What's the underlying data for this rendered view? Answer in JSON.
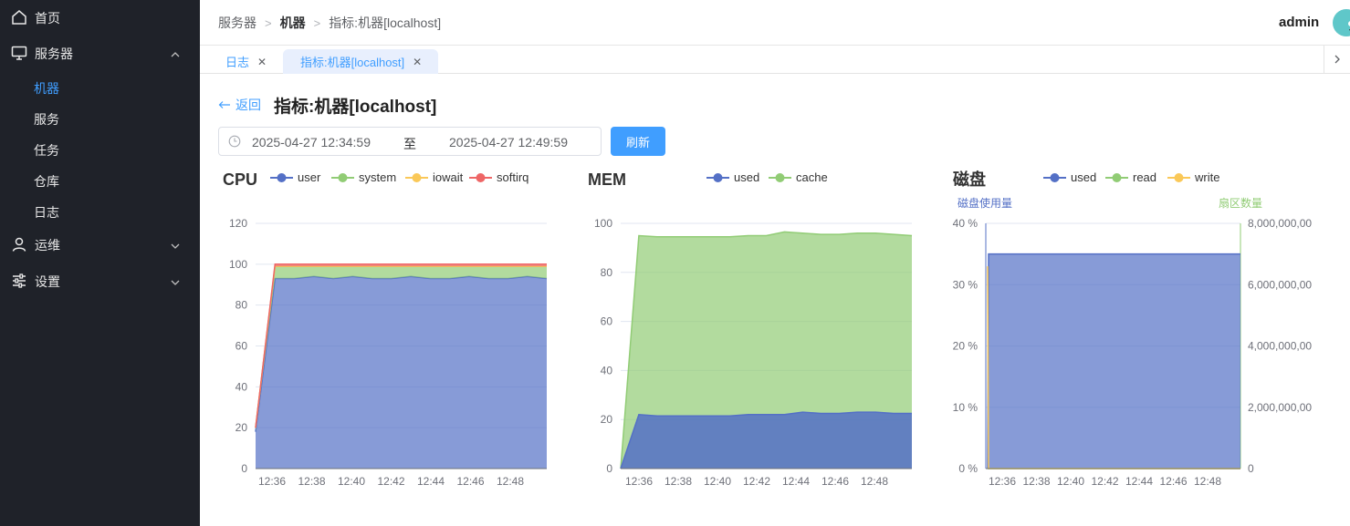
{
  "sidebar": {
    "items": [
      {
        "label": "首页",
        "icon": "home-icon"
      },
      {
        "label": "服务器",
        "icon": "monitor-icon",
        "expanded": true,
        "children": [
          {
            "label": "机器",
            "active": true
          },
          {
            "label": "服务"
          },
          {
            "label": "任务"
          },
          {
            "label": "仓库"
          },
          {
            "label": "日志"
          }
        ]
      },
      {
        "label": "运维",
        "icon": "user-icon",
        "expanded": false
      },
      {
        "label": "设置",
        "icon": "sliders-icon",
        "expanded": false
      }
    ]
  },
  "header": {
    "breadcrumb": [
      "服务器",
      "机器",
      "指标:机器[localhost]"
    ],
    "user": "admin"
  },
  "tabs": [
    {
      "label": "日志",
      "active": false
    },
    {
      "label": "指标:机器[localhost]",
      "active": true
    }
  ],
  "page": {
    "back_label": "返回",
    "title": "指标:机器[localhost]",
    "date_start": "2025-04-27 12:34:59",
    "date_sep": "至",
    "date_end": "2025-04-27 12:49:59",
    "refresh_label": "刷新"
  },
  "colors": {
    "accent": "#409eff",
    "sidebar_bg": "#1f2229",
    "blue": "#5470c6",
    "green": "#91cc75",
    "yellow": "#fac858",
    "red": "#ee6666"
  },
  "chart_data": [
    {
      "type": "area",
      "title": "CPU",
      "legend": [
        "user",
        "system",
        "iowait",
        "softirq"
      ],
      "x_ticks": [
        "12:36",
        "12:38",
        "12:40",
        "12:42",
        "12:44",
        "12:46",
        "12:48"
      ],
      "y_ticks": [
        "0",
        "20",
        "40",
        "60",
        "80",
        "100",
        "120"
      ],
      "ylim": [
        0,
        120
      ],
      "stacked": true,
      "series": [
        {
          "name": "user",
          "values": [
            18,
            93,
            93,
            94,
            93,
            94,
            93,
            93,
            94,
            93,
            93,
            94,
            93,
            93,
            94,
            93
          ]
        },
        {
          "name": "system",
          "values": [
            2,
            6,
            6,
            5,
            6,
            5,
            6,
            6,
            5,
            6,
            6,
            5,
            6,
            6,
            5,
            6
          ]
        },
        {
          "name": "iowait",
          "values": [
            0,
            0,
            0,
            0,
            0,
            0,
            0,
            0,
            0,
            0,
            0,
            0,
            0,
            0,
            0,
            0
          ]
        },
        {
          "name": "softirq",
          "values": [
            0,
            1,
            1,
            1,
            1,
            1,
            1,
            1,
            1,
            1,
            1,
            1,
            1,
            1,
            1,
            1
          ]
        }
      ]
    },
    {
      "type": "area",
      "title": "MEM",
      "legend": [
        "used",
        "cache"
      ],
      "x_ticks": [
        "12:36",
        "12:38",
        "12:40",
        "12:42",
        "12:44",
        "12:46",
        "12:48"
      ],
      "y_ticks": [
        "0",
        "20",
        "40",
        "60",
        "80",
        "100"
      ],
      "ylim": [
        0,
        100
      ],
      "series": [
        {
          "name": "used",
          "values": [
            0,
            22,
            21.5,
            21.5,
            21.5,
            21.5,
            21.5,
            22,
            22,
            22,
            23,
            22.5,
            22.5,
            23,
            23,
            22.5,
            22.5
          ]
        },
        {
          "name": "cache",
          "values": [
            0,
            95,
            94.5,
            94.5,
            94.5,
            94.5,
            94.5,
            95,
            95,
            96.5,
            96,
            95.5,
            95.5,
            96,
            96,
            95.5,
            95
          ]
        }
      ]
    },
    {
      "type": "area",
      "title": "磁盘",
      "legend": [
        "used",
        "read",
        "write"
      ],
      "left_axis_name": "磁盘使用量",
      "right_axis_name": "扇区数量",
      "x_ticks": [
        "12:36",
        "12:38",
        "12:40",
        "12:42",
        "12:44",
        "12:46",
        "12:48"
      ],
      "y_ticks_left": [
        "0 %",
        "10 %",
        "20 %",
        "30 %",
        "40 %"
      ],
      "y_ticks_right": [
        "0",
        "2,000,000,00",
        "4,000,000,00",
        "6,000,000,00",
        "8,000,000,00"
      ],
      "ylim_left": [
        0,
        40
      ],
      "ylim_right": [
        0,
        8000000000
      ],
      "series": [
        {
          "name": "used",
          "axis": "left",
          "values": [
            0,
            35,
            35,
            35,
            35,
            35,
            35,
            35,
            35,
            35
          ]
        },
        {
          "name": "read",
          "axis": "right",
          "values": [
            0,
            0,
            0,
            0,
            0,
            0,
            0,
            0,
            0,
            0
          ]
        },
        {
          "name": "write",
          "axis": "right",
          "values": [
            6600000000,
            0,
            0,
            0,
            0,
            0,
            0,
            0,
            0,
            0
          ]
        }
      ]
    }
  ]
}
